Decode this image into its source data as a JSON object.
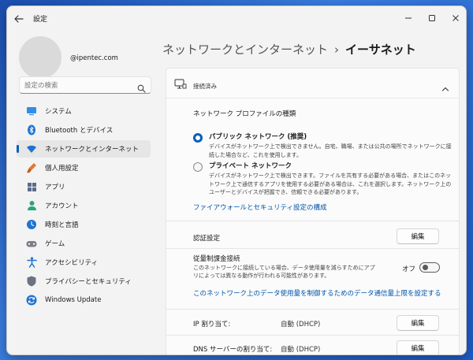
{
  "window": {
    "app_title": "設定"
  },
  "user": {
    "email": "@ipentec.com"
  },
  "search": {
    "placeholder": "設定の検索"
  },
  "sidebar": {
    "items": [
      {
        "label": "システム",
        "icon": "monitor-icon",
        "active": false
      },
      {
        "label": "Bluetooth とデバイス",
        "icon": "bluetooth-icon",
        "active": false
      },
      {
        "label": "ネットワークとインターネット",
        "icon": "wifi-icon",
        "active": true
      },
      {
        "label": "個人用設定",
        "icon": "brush-icon",
        "active": false
      },
      {
        "label": "アプリ",
        "icon": "apps-icon",
        "active": false
      },
      {
        "label": "アカウント",
        "icon": "person-icon",
        "active": false
      },
      {
        "label": "時刻と言語",
        "icon": "clock-globe-icon",
        "active": false
      },
      {
        "label": "ゲーム",
        "icon": "gamepad-icon",
        "active": false
      },
      {
        "label": "アクセシビリティ",
        "icon": "accessibility-icon",
        "active": false
      },
      {
        "label": "プライバシーとセキュリティ",
        "icon": "shield-icon",
        "active": false
      },
      {
        "label": "Windows Update",
        "icon": "update-icon",
        "active": false
      }
    ]
  },
  "breadcrumb": {
    "parent": "ネットワークとインターネット",
    "separator": "›",
    "current": "イーサネット"
  },
  "connection": {
    "status": "接続済み"
  },
  "profile": {
    "heading": "ネットワーク プロファイルの種類",
    "public_title": "パブリック ネットワーク (推奨)",
    "public_desc": "デバイスがネットワーク上で検出できません。自宅、職場、または公共の場所でネットワークに接続した場合など、これを使用します。",
    "private_title": "プライベート ネットワーク",
    "private_desc": "デバイスがネットワーク上で検出できます。ファイルを共有する必要がある場合、またはこのネットワーク上で通信するアプリを使用する必要がある場合は、これを選択します。ネットワーク上のユーザーとデバイスが把握でき、信頼できる必要があります。",
    "selected": "public",
    "firewall_link": "ファイアウォールとセキュリティ設定の構成"
  },
  "auth": {
    "label": "認証設定",
    "edit_label": "編集"
  },
  "metered": {
    "label": "従量制課金接続",
    "desc": "このネットワークに接続している場合、データ使用量を減らすためにアプリによっては異なる動作が行われる可能性があります。",
    "state_label": "オフ",
    "data_limit_link": "このネットワーク上のデータ使用量を制御するためのデータ通信量上限を設定する"
  },
  "ip": {
    "label": "IP 割り当て:",
    "value": "自動 (DHCP)",
    "edit_label": "編集"
  },
  "dns": {
    "label": "DNS サーバーの割り当て:",
    "value": "自動 (DHCP)",
    "edit_label": "編集"
  },
  "colors": {
    "accent": "#005fb8",
    "link": "#0055aa"
  }
}
